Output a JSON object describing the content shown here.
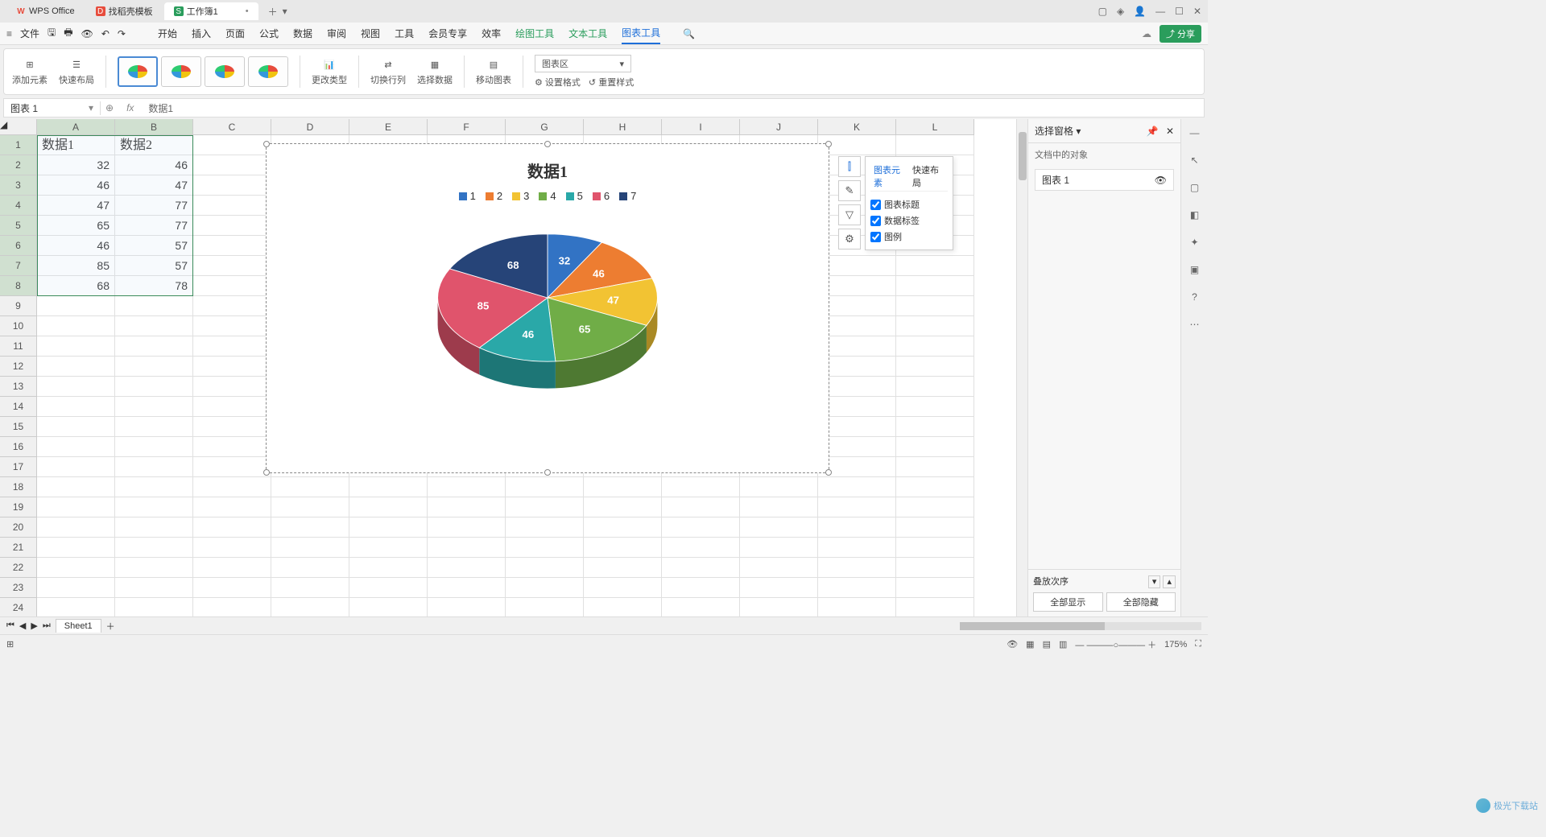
{
  "titlebar": {
    "tabs": [
      {
        "label": "WPS Office",
        "ico": "W",
        "ico_color": "#e74c3c"
      },
      {
        "label": "找稻壳模板",
        "ico": "D",
        "ico_color": "#e74c3c"
      },
      {
        "label": "工作簿1",
        "ico": "S",
        "ico_color": "#2a9d5c",
        "active": true
      }
    ]
  },
  "menubar": {
    "file": " 文件",
    "tabs": [
      "开始",
      "插入",
      "页面",
      "公式",
      "数据",
      "审阅",
      "视图",
      "工具",
      "会员专享",
      "效率"
    ],
    "tool_tabs": [
      "绘图工具",
      "文本工具",
      "图表工具"
    ],
    "active_tool_tab": "图表工具",
    "share": "分享"
  },
  "ribbon": {
    "add_element": "添加元素",
    "quick_layout": "快速布局",
    "change_type": "更改类型",
    "switch_rowcol": "切换行列",
    "select_data": "选择数据",
    "move_chart": "移动图表",
    "area_select": "图表区",
    "set_format": "设置格式",
    "reset_style": "重置样式"
  },
  "namebox": "图表 1",
  "formula": "数据1",
  "columns": [
    "A",
    "B",
    "C",
    "D",
    "E",
    "F",
    "G",
    "H",
    "I",
    "J",
    "K",
    "L"
  ],
  "rows": 25,
  "data": {
    "headers": [
      "数据1",
      "数据2"
    ],
    "col1": [
      32,
      46,
      47,
      65,
      46,
      85,
      68
    ],
    "col2": [
      46,
      47,
      77,
      77,
      57,
      57,
      78
    ]
  },
  "chart_data": {
    "type": "pie",
    "title": "数据1",
    "categories": [
      "1",
      "2",
      "3",
      "4",
      "5",
      "6",
      "7"
    ],
    "values": [
      32,
      46,
      47,
      65,
      46,
      85,
      68
    ],
    "colors": [
      "#3273c4",
      "#ed7d31",
      "#f2c333",
      "#70ad47",
      "#2aa8a8",
      "#e0546c",
      "#264478"
    ],
    "legend_position": "top"
  },
  "chart_side_options": {
    "tab_elements": "图表元素",
    "tab_layout": "快速布局",
    "checks": [
      {
        "label": "图表标题",
        "checked": true
      },
      {
        "label": "数据标签",
        "checked": true
      },
      {
        "label": "图例",
        "checked": true
      }
    ]
  },
  "right_panel": {
    "title": "选择窗格",
    "section": "文档中的对象",
    "items": [
      "图表 1"
    ],
    "order": "叠放次序",
    "show_all": "全部显示",
    "hide_all": "全部隐藏"
  },
  "sheet_tabs": [
    "Sheet1"
  ],
  "statusbar": {
    "zoom": "175%"
  },
  "watermark": "极光下载站"
}
